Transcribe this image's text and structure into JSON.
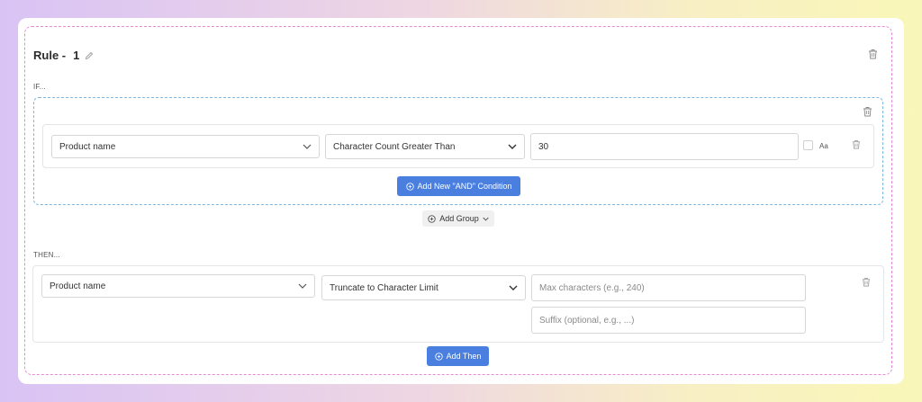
{
  "rule": {
    "title_prefix": "Rule -",
    "number": "1"
  },
  "if_section": {
    "label": "IF...",
    "condition": {
      "field": "Product name",
      "operator": "Character Count Greater Than",
      "value": "30",
      "case_sensitive_label": "Aa",
      "case_sensitive_checked": false
    },
    "add_and_label": "Add New \"AND\" Condition",
    "add_group_label": "Add Group"
  },
  "then_section": {
    "label": "THEN...",
    "action": {
      "field": "Product name",
      "operation": "Truncate to Character Limit",
      "max_chars_placeholder": "Max characters (e.g., 240)",
      "suffix_placeholder": "Suffix (optional, e.g., ...)"
    },
    "add_then_label": "Add Then"
  },
  "colors": {
    "primary_button": "#4a7fe0",
    "rule_border": "#e58bd2",
    "group_border": "#7fb7e0"
  },
  "icons": {
    "edit": "pencil-icon",
    "delete": "trash-icon",
    "dropdown": "chevron-down-icon",
    "add": "circle-plus-icon"
  }
}
